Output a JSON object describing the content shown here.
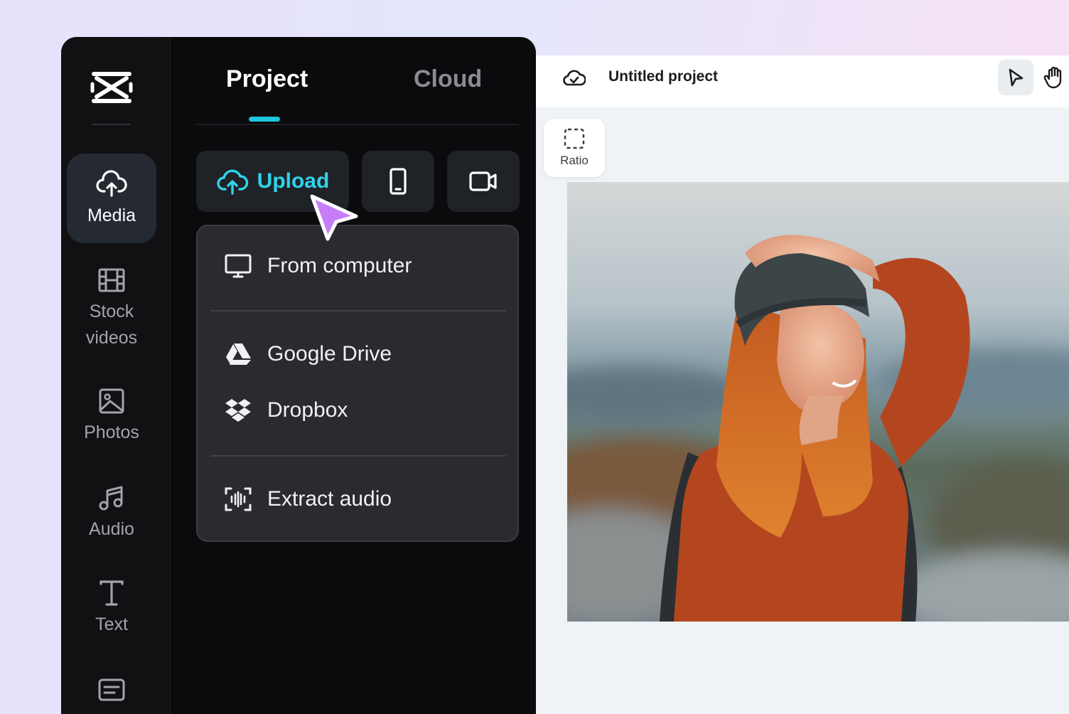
{
  "sidebar": {
    "items": [
      {
        "label": "Media",
        "icon": "cloud-upload-icon",
        "active": true
      },
      {
        "label": "Stock\nvideos",
        "icon": "film-icon"
      },
      {
        "label": "Photos",
        "icon": "image-icon"
      },
      {
        "label": "Audio",
        "icon": "music-note-icon"
      },
      {
        "label": "Text",
        "icon": "text-icon"
      },
      {
        "label": "",
        "icon": "captions-icon"
      }
    ]
  },
  "tabs": {
    "project": "Project",
    "cloud": "Cloud"
  },
  "upload": {
    "label": "Upload",
    "accent": "#2fd4ea"
  },
  "dropdown": {
    "from_computer": "From computer",
    "google_drive": "Google Drive",
    "dropbox": "Dropbox",
    "extract_audio": "Extract audio"
  },
  "editor": {
    "project_title": "Untitled project",
    "ratio_label": "Ratio"
  },
  "colors": {
    "cursor": "#c77df7",
    "panel_bg": "#0b0b0d"
  }
}
